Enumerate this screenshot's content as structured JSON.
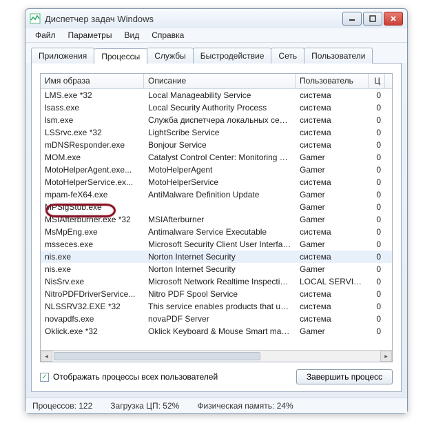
{
  "window": {
    "title": "Диспетчер задач Windows"
  },
  "menubar": [
    "Файл",
    "Параметры",
    "Вид",
    "Справка"
  ],
  "tabs": [
    "Приложения",
    "Процессы",
    "Службы",
    "Быстродействие",
    "Сеть",
    "Пользователи"
  ],
  "active_tab_index": 1,
  "columns": [
    "Имя образа",
    "Описание",
    "Пользователь",
    "Ц"
  ],
  "rows": [
    {
      "name": "LMS.exe *32",
      "desc": "Local Manageability Service",
      "user": "система",
      "cpu": "0"
    },
    {
      "name": "lsass.exe",
      "desc": "Local Security Authority Process",
      "user": "система",
      "cpu": "0"
    },
    {
      "name": "lsm.exe",
      "desc": "Служба диспетчера локальных сеансов",
      "user": "система",
      "cpu": "0"
    },
    {
      "name": "LSSrvc.exe *32",
      "desc": "LightScribe Service",
      "user": "система",
      "cpu": "0"
    },
    {
      "name": "mDNSResponder.exe",
      "desc": "Bonjour Service",
      "user": "система",
      "cpu": "0"
    },
    {
      "name": "MOM.exe",
      "desc": "Catalyst Control Center: Monitoring prog...",
      "user": "Gamer",
      "cpu": "0"
    },
    {
      "name": "MotoHelperAgent.exe...",
      "desc": "MotoHelperAgent",
      "user": "Gamer",
      "cpu": "0"
    },
    {
      "name": "MotoHelperService.ex...",
      "desc": "MotoHelperService",
      "user": "система",
      "cpu": "0"
    },
    {
      "name": "mpam-feX64.exe",
      "desc": "AntiMalware Definition Update",
      "user": "Gamer",
      "cpu": "0"
    },
    {
      "name": "MPSigStub.exe",
      "desc": "",
      "user": "Gamer",
      "cpu": "0"
    },
    {
      "name": "MSIAfterburner.exe *32",
      "desc": "MSIAfterburner",
      "user": "Gamer",
      "cpu": "0"
    },
    {
      "name": "MsMpEng.exe",
      "desc": "Antimalware Service Executable",
      "user": "система",
      "cpu": "0"
    },
    {
      "name": "msseces.exe",
      "desc": "Microsoft Security Client User Interface",
      "user": "Gamer",
      "cpu": "0"
    },
    {
      "name": "nis.exe",
      "desc": "Norton Internet Security",
      "user": "система",
      "cpu": "0",
      "selected": true
    },
    {
      "name": "nis.exe",
      "desc": "Norton Internet Security",
      "user": "Gamer",
      "cpu": "0"
    },
    {
      "name": "NisSrv.exe",
      "desc": "Microsoft Network Realtime Inspection S...",
      "user": "LOCAL SERVICE",
      "cpu": "0"
    },
    {
      "name": "NitroPDFDriverService...",
      "desc": "Nitro PDF Spool Service",
      "user": "система",
      "cpu": "0"
    },
    {
      "name": "NLSSRV32.EXE *32",
      "desc": "This service enables products that use t...",
      "user": "система",
      "cpu": "0"
    },
    {
      "name": "novapdfs.exe",
      "desc": "novaPDF Server",
      "user": "система",
      "cpu": "0"
    },
    {
      "name": "Oklick.exe *32",
      "desc": "Oklick Keyboard & Mouse Smart manager",
      "user": "Gamer",
      "cpu": "0"
    }
  ],
  "checkbox": {
    "checked": true,
    "label": "Отображать процессы всех пользователей"
  },
  "end_process_button": "Завершить процесс",
  "status": {
    "processes_label": "Процессов: 122",
    "cpu_label": "Загрузка ЦП: 52%",
    "mem_label": "Физическая память: 24%"
  }
}
